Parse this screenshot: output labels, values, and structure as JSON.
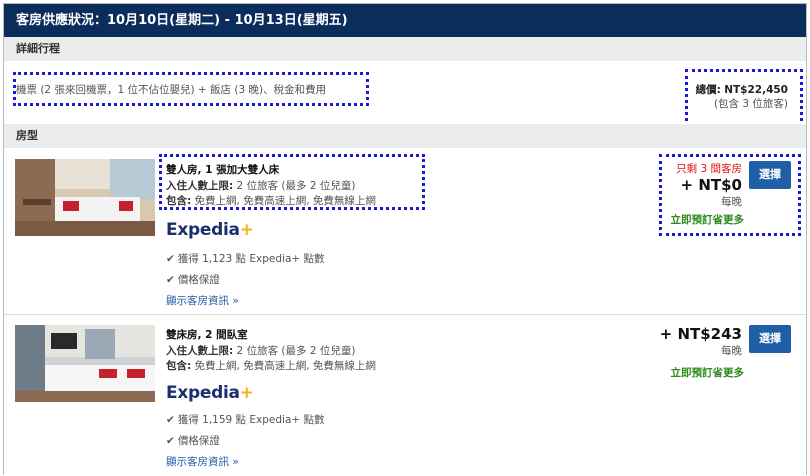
{
  "header": {
    "title": "客房供應狀況：10月10日(星期二) - 10月13日(星期五)"
  },
  "itinerary": {
    "section_label": "詳細行程",
    "description": "機票 (2 張來回機票，1 位不佔位嬰兒) + 飯店 (3 晚)、稅金和費用",
    "total_label": "總價:",
    "total_value": "NT$22,450",
    "travelers_note": "(包含 3 位旅客)"
  },
  "room_section": {
    "label": "房型"
  },
  "rooms": [
    {
      "name": "雙人房, 1 張加大雙人床",
      "occupancy_label": "入住人數上限:",
      "occupancy_value": "2 位旅客 (最多 2 位兒童)",
      "includes_label": "包含:",
      "includes_value": "免費上網, 免費高速上網, 免費無線上網",
      "brand": "Expedia",
      "brand_plus": "+",
      "points": "獲得 1,123 點 Expedia+ 點數",
      "guarantee": "價格保證",
      "more_info": "顯示客房資訊",
      "more_info_chevron": "»",
      "scarcity": "只剩 3 間客房",
      "price": "+ NT$0",
      "per_night": "每晚",
      "save_more": "立即預訂省更多",
      "select_label": "選擇"
    },
    {
      "name": "雙床房, 2 間臥室",
      "occupancy_label": "入住人數上限:",
      "occupancy_value": "2 位旅客 (最多 2 位兒童)",
      "includes_label": "包含:",
      "includes_value": "免費上網, 免費高速上網, 免費無線上網",
      "brand": "Expedia",
      "brand_plus": "+",
      "points": "獲得 1,159 點 Expedia+ 點數",
      "guarantee": "價格保證",
      "more_info": "顯示客房資訊",
      "more_info_chevron": "»",
      "price": "+ NT$243",
      "per_night": "每晚",
      "save_more": "立即預訂省更多",
      "select_label": "選擇"
    }
  ],
  "colors": {
    "header_bg": "#0a2d5c",
    "accent_blue": "#1f5fa8",
    "scarcity_red": "#dd1111",
    "save_green": "#2f8a1e",
    "brand_navy": "#1b2f6d",
    "brand_plus": "#f3b41a",
    "highlight_dotted": "#1a1ad6"
  },
  "icons": [
    "check-icon",
    "chevron-down-icon"
  ]
}
